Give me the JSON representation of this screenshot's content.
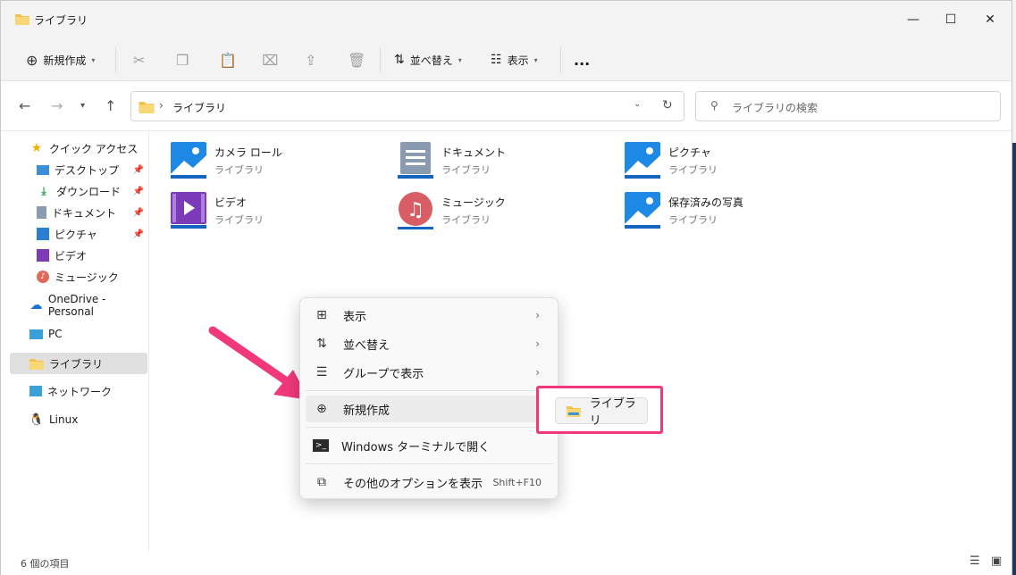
{
  "window": {
    "title": "ライブラリ"
  },
  "toolbar": {
    "new_label": "新規作成",
    "sort_label": "並べ替え",
    "view_label": "表示",
    "more_label": "..."
  },
  "navbar": {
    "address_path": "ライブラリ",
    "search_placeholder": "ライブラリの検索"
  },
  "sidebar": {
    "items": [
      {
        "label": "クイック アクセス",
        "icon": "star-icon"
      },
      {
        "label": "デスクトップ",
        "icon": "desktop-icon",
        "pinned": true
      },
      {
        "label": "ダウンロード",
        "icon": "download-icon",
        "pinned": true
      },
      {
        "label": "ドキュメント",
        "icon": "document-icon",
        "pinned": true
      },
      {
        "label": "ピクチャ",
        "icon": "picture-icon",
        "pinned": true
      },
      {
        "label": "ビデオ",
        "icon": "video-icon"
      },
      {
        "label": "ミュージック",
        "icon": "music-icon"
      },
      {
        "label": "OneDrive - Personal",
        "icon": "cloud-icon"
      },
      {
        "label": "PC",
        "icon": "pc-icon"
      },
      {
        "label": "ライブラリ",
        "icon": "folder-icon",
        "selected": true
      },
      {
        "label": "ネットワーク",
        "icon": "network-icon"
      },
      {
        "label": "Linux",
        "icon": "linux-icon"
      }
    ]
  },
  "libraries": [
    {
      "name": "カメラ ロール",
      "type": "ライブラリ",
      "icon": "picture-library-icon"
    },
    {
      "name": "ドキュメント",
      "type": "ライブラリ",
      "icon": "document-library-icon"
    },
    {
      "name": "ピクチャ",
      "type": "ライブラリ",
      "icon": "picture-library-icon"
    },
    {
      "name": "ビデオ",
      "type": "ライブラリ",
      "icon": "video-library-icon"
    },
    {
      "name": "ミュージック",
      "type": "ライブラリ",
      "icon": "music-library-icon"
    },
    {
      "name": "保存済みの写真",
      "type": "ライブラリ",
      "icon": "picture-library-icon"
    }
  ],
  "context_menu": {
    "items": [
      {
        "label": "表示",
        "icon": "grid-icon",
        "has_submenu": true
      },
      {
        "label": "並べ替え",
        "icon": "sort-icon",
        "has_submenu": true
      },
      {
        "label": "グループで表示",
        "icon": "group-icon",
        "has_submenu": true
      },
      {
        "label": "新規作成",
        "icon": "plus-circle-icon"
      },
      {
        "label": "Windows ターミナルで開く",
        "icon": "terminal-icon"
      },
      {
        "label": "その他のオプションを表示",
        "icon": "external-icon",
        "shortcut": "Shift+F10"
      }
    ],
    "submenu_item": "ライブラリ"
  },
  "status": {
    "item_count": "6 個の項目"
  },
  "colors": {
    "highlight": "#f0387a",
    "accent": "#0067c0"
  }
}
